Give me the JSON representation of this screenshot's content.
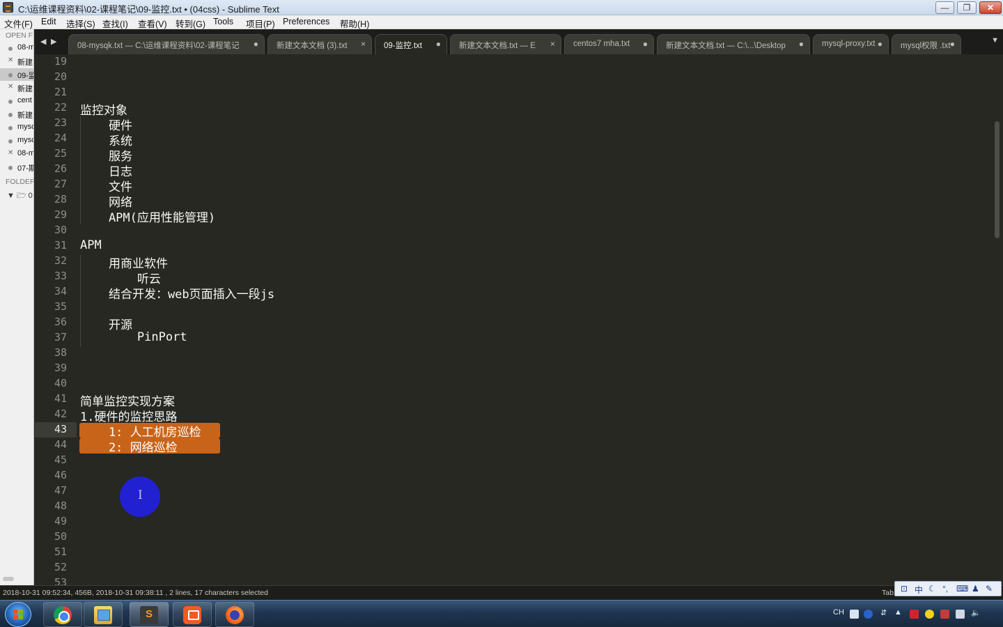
{
  "window": {
    "title": "C:\\运维课程资料\\02-课程笔记\\09-监控.txt • (04css) - Sublime Text",
    "minimize": "—",
    "maximize": "❐",
    "close": "✕"
  },
  "menu": [
    "文件(F)",
    "Edit",
    "选择(S)",
    "查找(I)",
    "查看(V)",
    "转到(G)",
    "Tools",
    "项目(P)",
    "Preferences",
    "帮助(H)"
  ],
  "sidebar": {
    "open_files_header": "OPEN F",
    "folders_header": "FOLDER",
    "folder_name": "0",
    "items": [
      {
        "name": "08-m",
        "mark": "dot",
        "active": false
      },
      {
        "name": "新建",
        "mark": "x",
        "active": false
      },
      {
        "name": "09-监",
        "mark": "dot",
        "active": true
      },
      {
        "name": "新建",
        "mark": "x",
        "active": false
      },
      {
        "name": "cent",
        "mark": "dot",
        "active": false
      },
      {
        "name": "新建",
        "mark": "dot",
        "active": false
      },
      {
        "name": "mysc",
        "mark": "dot",
        "active": false
      },
      {
        "name": "mysc",
        "mark": "dot",
        "active": false
      },
      {
        "name": "08-m",
        "mark": "x",
        "active": false
      },
      {
        "name": "07-期",
        "mark": "dot",
        "active": false
      }
    ]
  },
  "tabs": [
    {
      "label": "08-mysqk.txt — C:\\运维课程资料\\02-课程笔记",
      "indicator": "●",
      "active": false
    },
    {
      "label": "新建文本文档 (3).txt",
      "indicator": "×",
      "active": false
    },
    {
      "label": "09-监控.txt",
      "indicator": "●",
      "active": true
    },
    {
      "label": "新建文本文档.txt — E",
      "indicator": "×",
      "active": false
    },
    {
      "label": "centos7 mha.txt",
      "indicator": "●",
      "active": false
    },
    {
      "label": "新建文本文档.txt — C:\\...\\Desktop",
      "indicator": "●",
      "active": false
    },
    {
      "label": "mysql-proxy.txt",
      "indicator": "●",
      "active": false
    },
    {
      "label": "mysql权限 .txt",
      "indicator": "●",
      "active": false
    }
  ],
  "editor": {
    "current_line": 43,
    "lines": [
      {
        "n": 19,
        "text": ""
      },
      {
        "n": 20,
        "text": ""
      },
      {
        "n": 21,
        "text": ""
      },
      {
        "n": 22,
        "text": "监控对象"
      },
      {
        "n": 23,
        "text": "    硬件"
      },
      {
        "n": 24,
        "text": "    系统"
      },
      {
        "n": 25,
        "text": "    服务"
      },
      {
        "n": 26,
        "text": "    日志"
      },
      {
        "n": 27,
        "text": "    文件"
      },
      {
        "n": 28,
        "text": "    网络"
      },
      {
        "n": 29,
        "text": "    APM(应用性能管理)"
      },
      {
        "n": 30,
        "text": ""
      },
      {
        "n": 31,
        "text": "APM"
      },
      {
        "n": 32,
        "text": "    用商业软件"
      },
      {
        "n": 33,
        "text": "        听云"
      },
      {
        "n": 34,
        "text": "    结合开发：web页面插入一段js"
      },
      {
        "n": 35,
        "text": ""
      },
      {
        "n": 36,
        "text": "    开源"
      },
      {
        "n": 37,
        "text": "        PinPort"
      },
      {
        "n": 38,
        "text": ""
      },
      {
        "n": 39,
        "text": ""
      },
      {
        "n": 40,
        "text": ""
      },
      {
        "n": 41,
        "text": "简单监控实现方案"
      },
      {
        "n": 42,
        "text": "1.硬件的监控思路"
      },
      {
        "n": 43,
        "text": "    1: 人工机房巡检",
        "selected": true
      },
      {
        "n": 44,
        "text": "    2: 网络巡检",
        "selected": true
      },
      {
        "n": 45,
        "text": ""
      },
      {
        "n": 46,
        "text": ""
      },
      {
        "n": 47,
        "text": ""
      },
      {
        "n": 48,
        "text": ""
      },
      {
        "n": 49,
        "text": ""
      },
      {
        "n": 50,
        "text": ""
      },
      {
        "n": 51,
        "text": ""
      },
      {
        "n": 52,
        "text": ""
      },
      {
        "n": 53,
        "text": ""
      }
    ]
  },
  "status": {
    "text": "2018-10-31 09:52:34, 456B, 2018-10-31 09:38:11 , 2 lines, 17 characters selected",
    "tab_size": "Tab"
  },
  "ime": {
    "lang": "中",
    "icons": [
      "ime-toolbar-icon",
      "chinese-mode-icon",
      "moon-icon",
      "punctuation-icon",
      "keyboard-icon",
      "user-icon",
      "wrench-icon"
    ]
  },
  "taskbar": {
    "apps": [
      "chrome-icon",
      "explorer-icon",
      "sublime-icon",
      "presentation-icon",
      "firefox-icon"
    ],
    "tray_lang": "CH"
  },
  "colors": {
    "editor_bg": "#272822",
    "selection": "#c8641a",
    "gutter_text": "#8f908a",
    "text": "#f8f8f2",
    "cursor_highlight": "#2121d1"
  }
}
